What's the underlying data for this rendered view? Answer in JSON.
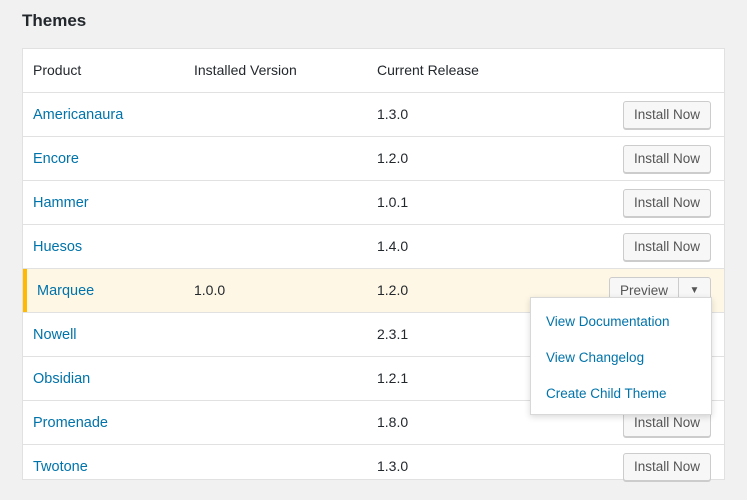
{
  "page": {
    "title": "Themes"
  },
  "table": {
    "columns": [
      "Product",
      "Installed Version",
      "Current Release"
    ],
    "rows": [
      {
        "product": "Americanaura",
        "installed": "",
        "current": "1.3.0",
        "action": "Install Now"
      },
      {
        "product": "Encore",
        "installed": "",
        "current": "1.2.0",
        "action": "Install Now"
      },
      {
        "product": "Hammer",
        "installed": "",
        "current": "1.0.1",
        "action": "Install Now"
      },
      {
        "product": "Huesos",
        "installed": "",
        "current": "1.4.0",
        "action": "Install Now"
      },
      {
        "product": "Marquee",
        "installed": "1.0.0",
        "current": "1.2.0",
        "action": "Preview",
        "active": true
      },
      {
        "product": "Nowell",
        "installed": "",
        "current": "2.3.1",
        "action": ""
      },
      {
        "product": "Obsidian",
        "installed": "",
        "current": "1.2.1",
        "action": ""
      },
      {
        "product": "Promenade",
        "installed": "",
        "current": "1.8.0",
        "action": "Install Now"
      },
      {
        "product": "Twotone",
        "installed": "",
        "current": "1.3.0",
        "action": "Install Now"
      }
    ]
  },
  "dropdown": {
    "items": [
      "View Documentation",
      "View Changelog",
      "Create Child Theme"
    ]
  },
  "icons": {
    "dropdown_toggle": "caret-down-icon"
  },
  "colors": {
    "link": "#0073aa",
    "active_row_bg": "#fef7e5",
    "active_row_accent": "#ffb900"
  }
}
